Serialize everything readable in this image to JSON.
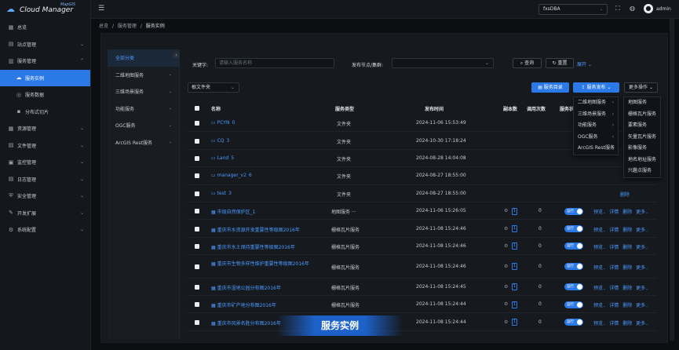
{
  "app": {
    "name": "Cloud Manager",
    "sup": "MapGIS"
  },
  "topbar": {
    "db": "fxsDBA",
    "user": "admin"
  },
  "sidebar": {
    "items": [
      {
        "label": "总览",
        "icon": "grid-icon",
        "glyph": "▦"
      },
      {
        "label": "站点管理",
        "icon": "site-icon",
        "glyph": "▤",
        "chev": "⌄"
      },
      {
        "label": "服务管理",
        "icon": "service-icon",
        "glyph": "▥",
        "chev": "⌃"
      },
      {
        "label": "服务实例",
        "icon": "cloud-icon",
        "glyph": "☁",
        "sub": true,
        "active": true
      },
      {
        "label": "服务数据",
        "icon": "data-icon",
        "glyph": "◎",
        "sub": true
      },
      {
        "label": "分布式切片",
        "icon": "tile-icon",
        "glyph": "▪",
        "sub": true
      },
      {
        "label": "资源管理",
        "icon": "resource-icon",
        "glyph": "▦",
        "chev": "⌄"
      },
      {
        "label": "文件管理",
        "icon": "file-icon",
        "glyph": "▤",
        "chev": "⌄"
      },
      {
        "label": "监控管理",
        "icon": "monitor-icon",
        "glyph": "▣",
        "chev": "⌄"
      },
      {
        "label": "日志管理",
        "icon": "log-icon",
        "glyph": "▤",
        "chev": "⌄"
      },
      {
        "label": "安全管理",
        "icon": "security-icon",
        "glyph": "⛨",
        "chev": "⌄"
      },
      {
        "label": "开发扩展",
        "icon": "extend-icon",
        "glyph": "✎",
        "chev": "⌄"
      },
      {
        "label": "系统配置",
        "icon": "gear-icon",
        "glyph": "⚙",
        "chev": "⌄"
      }
    ]
  },
  "breadcrumb": {
    "a": "总览",
    "b": "服务管理",
    "c": "服务实例",
    "sep": "/"
  },
  "categories": [
    {
      "label": "全部分类",
      "active": true
    },
    {
      "label": "二维地图服务",
      "chev": "⌄"
    },
    {
      "label": "三维场景服务",
      "chev": "⌄"
    },
    {
      "label": "功能服务",
      "chev": "⌄"
    },
    {
      "label": "OGC服务",
      "chev": "⌄"
    },
    {
      "label": "ArcGIS Rest服务",
      "chev": "⌄"
    }
  ],
  "filters": {
    "keyword_label": "关键字:",
    "keyword_placeholder": "请输入服务名称",
    "node_label": "发布节点/集群:",
    "query": "查询",
    "reset": "重置",
    "expand": "展开",
    "folder_select": "根文件夹",
    "catalog": "服务目录",
    "publish": "服务发布",
    "more": "更多操作"
  },
  "table": {
    "headers": {
      "name": "名称",
      "type": "服务类型",
      "time": "发布时间",
      "replicas": "副本数",
      "calls": "调用次数",
      "status": "服务状"
    },
    "folders": [
      {
        "name": "PCYN",
        "count": "0",
        "type": "文件夹",
        "time": "2024-11-06 15:53:49",
        "op": ""
      },
      {
        "name": "CQ",
        "count": "3",
        "type": "文件夹",
        "time": "2024-10-30 17:18:24",
        "op": ""
      },
      {
        "name": "Land",
        "count": "5",
        "type": "文件夹",
        "time": "2024-08-28 14:04:08",
        "op": ""
      },
      {
        "name": "manager_v2",
        "count": "6",
        "type": "文件夹",
        "time": "2024-08-27 18:55:00",
        "op": ""
      },
      {
        "name": "test",
        "count": "3",
        "type": "文件夹",
        "time": "2024-08-27 18:55:00",
        "op": "删除"
      }
    ],
    "services": [
      {
        "name": "市级自然保护区_1",
        "type": "地图服务 ···",
        "time": "2024-11-06 15:26:05",
        "replicas": "1",
        "calls": "0",
        "status": "运行"
      },
      {
        "name": "重庆市水资源开发重要性等级图2016年",
        "type": "栅格瓦片服务",
        "time": "2024-11-08 15:24:46",
        "replicas": "1",
        "calls": "0",
        "status": "运行"
      },
      {
        "name": "重庆市水土保持重要性等级图2016年",
        "type": "栅格瓦片服务",
        "time": "2024-11-08 15:24:46",
        "replicas": "1",
        "calls": "0",
        "status": "运行"
      },
      {
        "name": "重庆市生物多样性维护重要性等级图2016年",
        "type": "栅格瓦片服务",
        "time": "2024-11-08 15:24:46",
        "replicas": "1",
        "calls": "0",
        "status": "运行",
        "tall": true
      },
      {
        "name": "重庆市湿地公园分布图2016年",
        "type": "栅格瓦片服务",
        "time": "2024-11-08 15:24:45",
        "replicas": "1",
        "calls": "0",
        "status": "运行"
      },
      {
        "name": "重庆市矿产地分布图2016年",
        "type": "栅格瓦片服务",
        "time": "2024-11-08 15:24:44",
        "replicas": "1",
        "calls": "0",
        "status": "运行"
      },
      {
        "name": "重庆市风景名胜分布图2016年",
        "type": "栅格瓦片服务",
        "time": "2024-11-08 15:24:44",
        "replicas": "1",
        "calls": "0",
        "status": "运行"
      }
    ],
    "ops": {
      "preview": "预览",
      "detail": "详情",
      "delete": "删除",
      "more": "更多"
    }
  },
  "publish_menu": [
    {
      "label": "二维地图服务",
      "chev": "›"
    },
    {
      "label": "三维场景服务",
      "chev": "›"
    },
    {
      "label": "功能服务",
      "chev": "›"
    },
    {
      "label": "OGC服务",
      "chev": "›"
    },
    {
      "label": "ArcGIS Rest服务",
      "chev": "›"
    }
  ],
  "publish_submenu": [
    "地图服务",
    "栅格瓦片服务",
    "要素服务",
    "矢量瓦片服务",
    "影像服务",
    "地名地址服务",
    "兴趣点服务"
  ],
  "banner": "服务实例",
  "colors": {
    "accent": "#2a79e6",
    "bg": "#0c0e12",
    "panel": "#16191e"
  }
}
